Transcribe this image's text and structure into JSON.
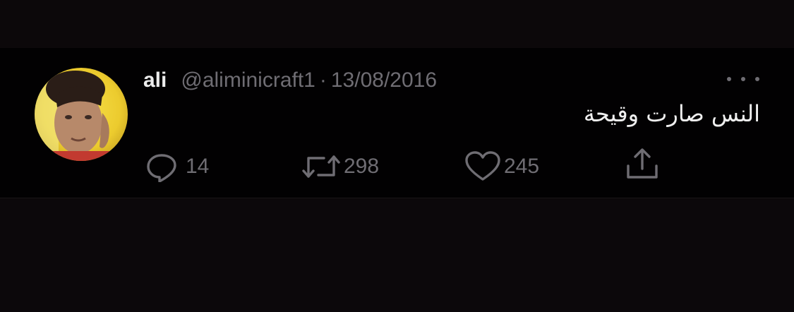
{
  "tweet": {
    "display_name": "ali",
    "handle": "@aliminicraft1",
    "separator": "·",
    "date": "13/08/2016",
    "text": "النس صارت وقيحة",
    "more_icon": "more-horizontal-icon",
    "avatar_icon": "avatar"
  },
  "actions": {
    "reply": {
      "icon": "reply-icon",
      "count": "14"
    },
    "retweet": {
      "icon": "retweet-icon",
      "count": "298"
    },
    "like": {
      "icon": "heart-icon",
      "count": "245"
    },
    "share": {
      "icon": "share-icon"
    }
  },
  "colors": {
    "background": "#020102",
    "text": "#efefef",
    "muted": "#6f6d73"
  }
}
